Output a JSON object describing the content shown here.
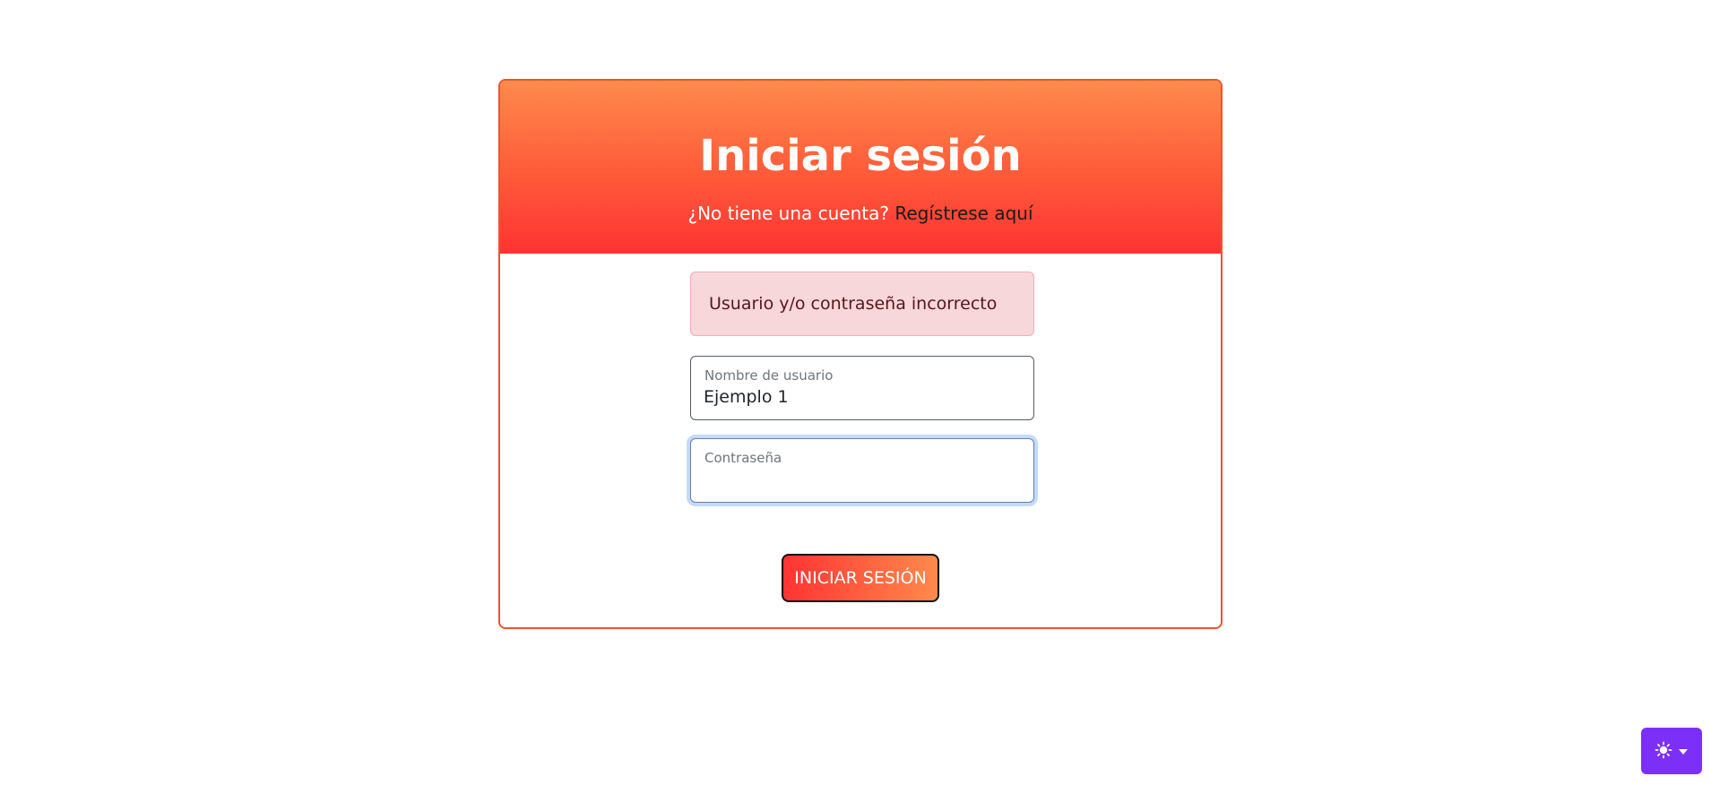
{
  "login": {
    "title": "Iniciar sesión",
    "no_account_text": "¿No tiene una cuenta?",
    "register_link": "Regístrese aquí",
    "error_message": "Usuario y/o contraseña incorrecto",
    "username": {
      "label": "Nombre de usuario",
      "value": "Ejemplo 1"
    },
    "password": {
      "label": "Contraseña",
      "value": ""
    },
    "submit_label": "INICIAR SESIÓN"
  },
  "theme_toggle": {
    "icon": "sun-icon",
    "caret_icon": "caret-down-icon"
  },
  "colors": {
    "header_gradient_top": "#ff8a4c",
    "header_gradient_bottom": "#ff3333",
    "card_border": "#e8572c",
    "alert_background": "#f8d7da",
    "alert_text": "#58151c",
    "theme_toggle_background": "#7b2ff7"
  }
}
